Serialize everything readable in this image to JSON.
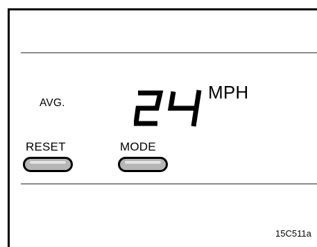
{
  "display": {
    "label_left": "AVG.",
    "value": "24",
    "unit": "MPH"
  },
  "buttons": {
    "reset_label": "RESET",
    "mode_label": "MODE"
  },
  "figure_code": "15C511a",
  "colors": {
    "frame": "#000000",
    "divider": "#8c8c8c",
    "button_fill": "#b6b6b6",
    "button_highlight": "#e4e4e4"
  }
}
